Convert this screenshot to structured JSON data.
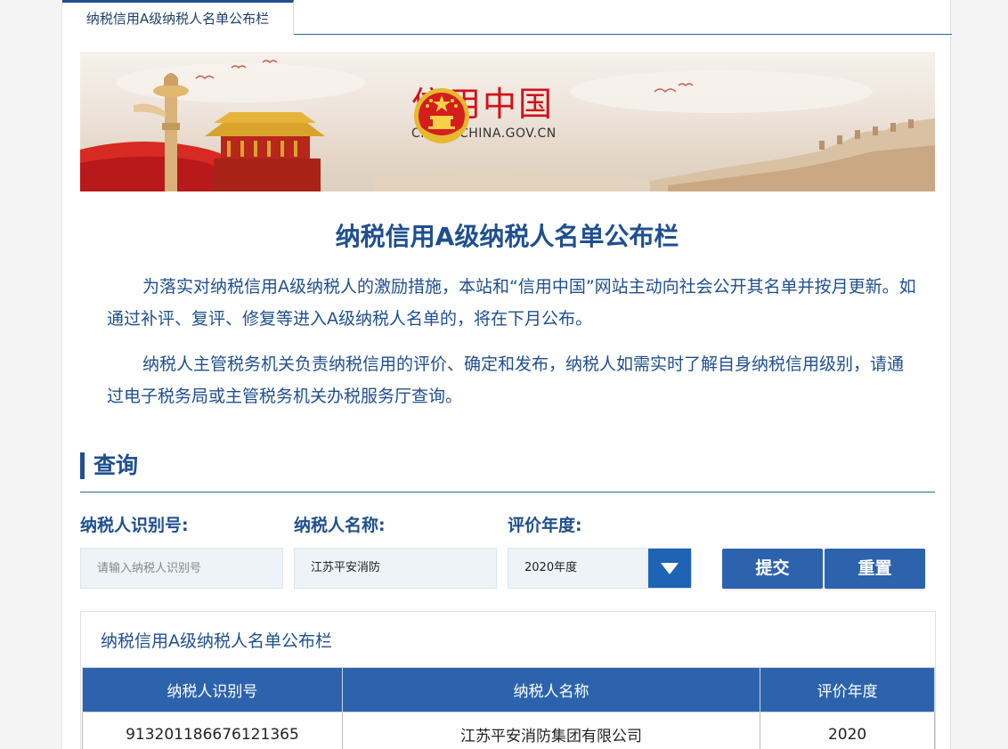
{
  "tab": {
    "label": "纳税信用A级纳税人名单公布栏"
  },
  "banner": {
    "brand_cn": "信用中国",
    "brand_en": "CREDITCHINA.GOV.CN"
  },
  "page_title": "纳税信用A级纳税人名单公布栏",
  "intro": [
    "为落实对纳税信用A级纳税人的激励措施，本站和“信用中国”网站主动向社会公开其名单并按月更新。如通过补评、复评、修复等进入A级纳税人名单的，将在下月公布。",
    "纳税人主管税务机关负责纳税信用的评价、确定和发布，纳税人如需实时了解自身纳税信用级别，请通过电子税务局或主管税务机关办税服务厅查询。"
  ],
  "query": {
    "section_title": "查询",
    "taxpayer_id_label": "纳税人识别号:",
    "taxpayer_id_placeholder": "请输入纳税人识别号",
    "taxpayer_id_value": "",
    "taxpayer_name_label": "纳税人名称:",
    "taxpayer_name_value": "江苏平安消防",
    "year_label": "评价年度:",
    "year_value": "2020年度",
    "submit_label": "提交",
    "reset_label": "重置"
  },
  "results": {
    "title": "纳税信用A级纳税人名单公布栏",
    "columns": [
      "纳税人识别号",
      "纳税人名称",
      "评价年度"
    ],
    "rows": [
      [
        "913201186676121365",
        "江苏平安消防集团有限公司",
        "2020"
      ]
    ]
  },
  "colors": {
    "primary": "#1f4f8f",
    "button": "#2d63ad",
    "brand_red": "#d0121a"
  }
}
